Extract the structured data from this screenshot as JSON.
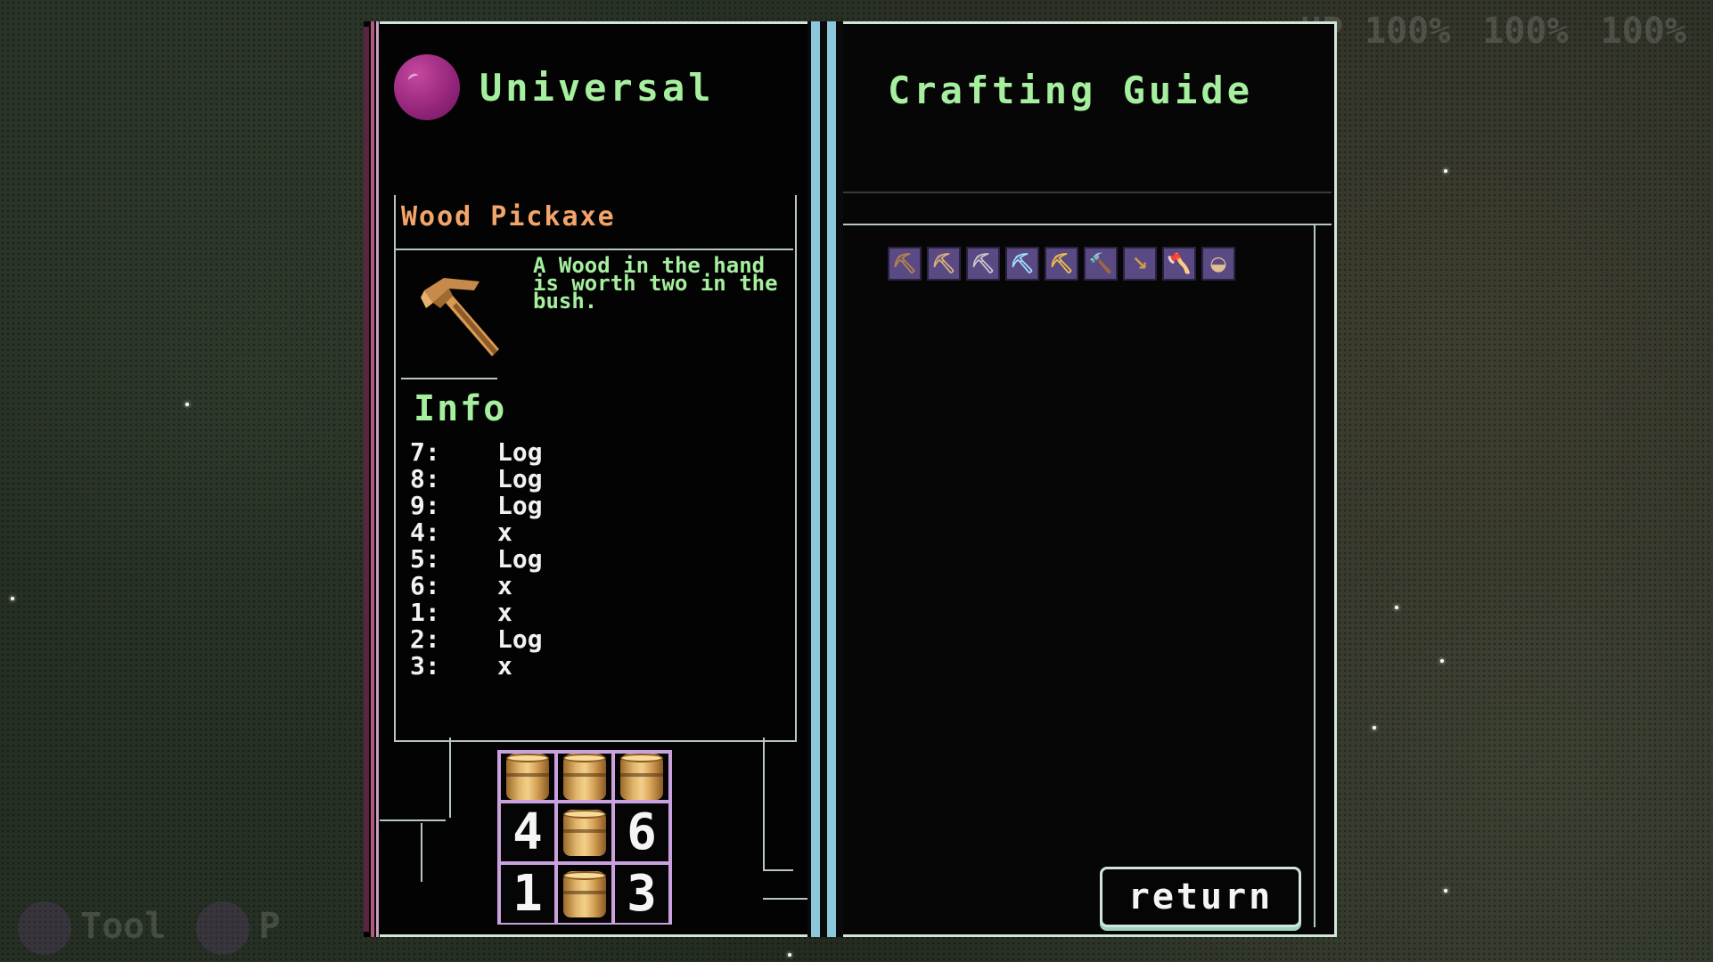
{
  "hud": {
    "hp": "HP 100%",
    "stat2": "100%",
    "stat3": "100%",
    "bottom_tool": "Tool",
    "bottom_item": "P"
  },
  "book": {
    "left_title": "Universal",
    "right_title": "Crafting Guide",
    "item": {
      "name": "Wood Pickaxe",
      "description": "A Wood in the hand is worth two in the bush."
    },
    "info_title": "Info",
    "recipe": [
      {
        "key": "7:",
        "value": "Log"
      },
      {
        "key": "8:",
        "value": "Log"
      },
      {
        "key": "9:",
        "value": "Log"
      },
      {
        "key": "4:",
        "value": "x"
      },
      {
        "key": "5:",
        "value": "Log"
      },
      {
        "key": "6:",
        "value": "x"
      },
      {
        "key": "1:",
        "value": "x"
      },
      {
        "key": "2:",
        "value": "Log"
      },
      {
        "key": "3:",
        "value": "x"
      }
    ],
    "grid_numbers": {
      "c4": "4",
      "c6": "6",
      "c1": "1",
      "c3": "3"
    },
    "tools": [
      {
        "icon": "wood-pickaxe-icon",
        "glyph": "⛏",
        "color": "#b8864a"
      },
      {
        "icon": "stone-pickaxe-icon",
        "glyph": "⛏",
        "color": "#d9b27a"
      },
      {
        "icon": "iron-pickaxe-icon",
        "glyph": "⛏",
        "color": "#c8c8c8"
      },
      {
        "icon": "diamond-pickaxe-icon",
        "glyph": "⛏",
        "color": "#9fe0ff"
      },
      {
        "icon": "gold-pickaxe-icon",
        "glyph": "⛏",
        "color": "#f2c14a"
      },
      {
        "icon": "hammer-icon",
        "glyph": "🔨",
        "color": "#c48a4a"
      },
      {
        "icon": "shovel-icon",
        "glyph": "↘",
        "color": "#d49a4a"
      },
      {
        "icon": "axe-icon",
        "glyph": "🪓",
        "color": "#c09060"
      },
      {
        "icon": "watering-can-icon",
        "glyph": "◒",
        "color": "#e0c090"
      }
    ],
    "return_label": "return"
  },
  "colors": {
    "title_green": "#a6ef9f",
    "item_orange": "#f3a46a",
    "spine_blue": "#8cc7dc",
    "grid_purple": "#c9a1dd"
  }
}
